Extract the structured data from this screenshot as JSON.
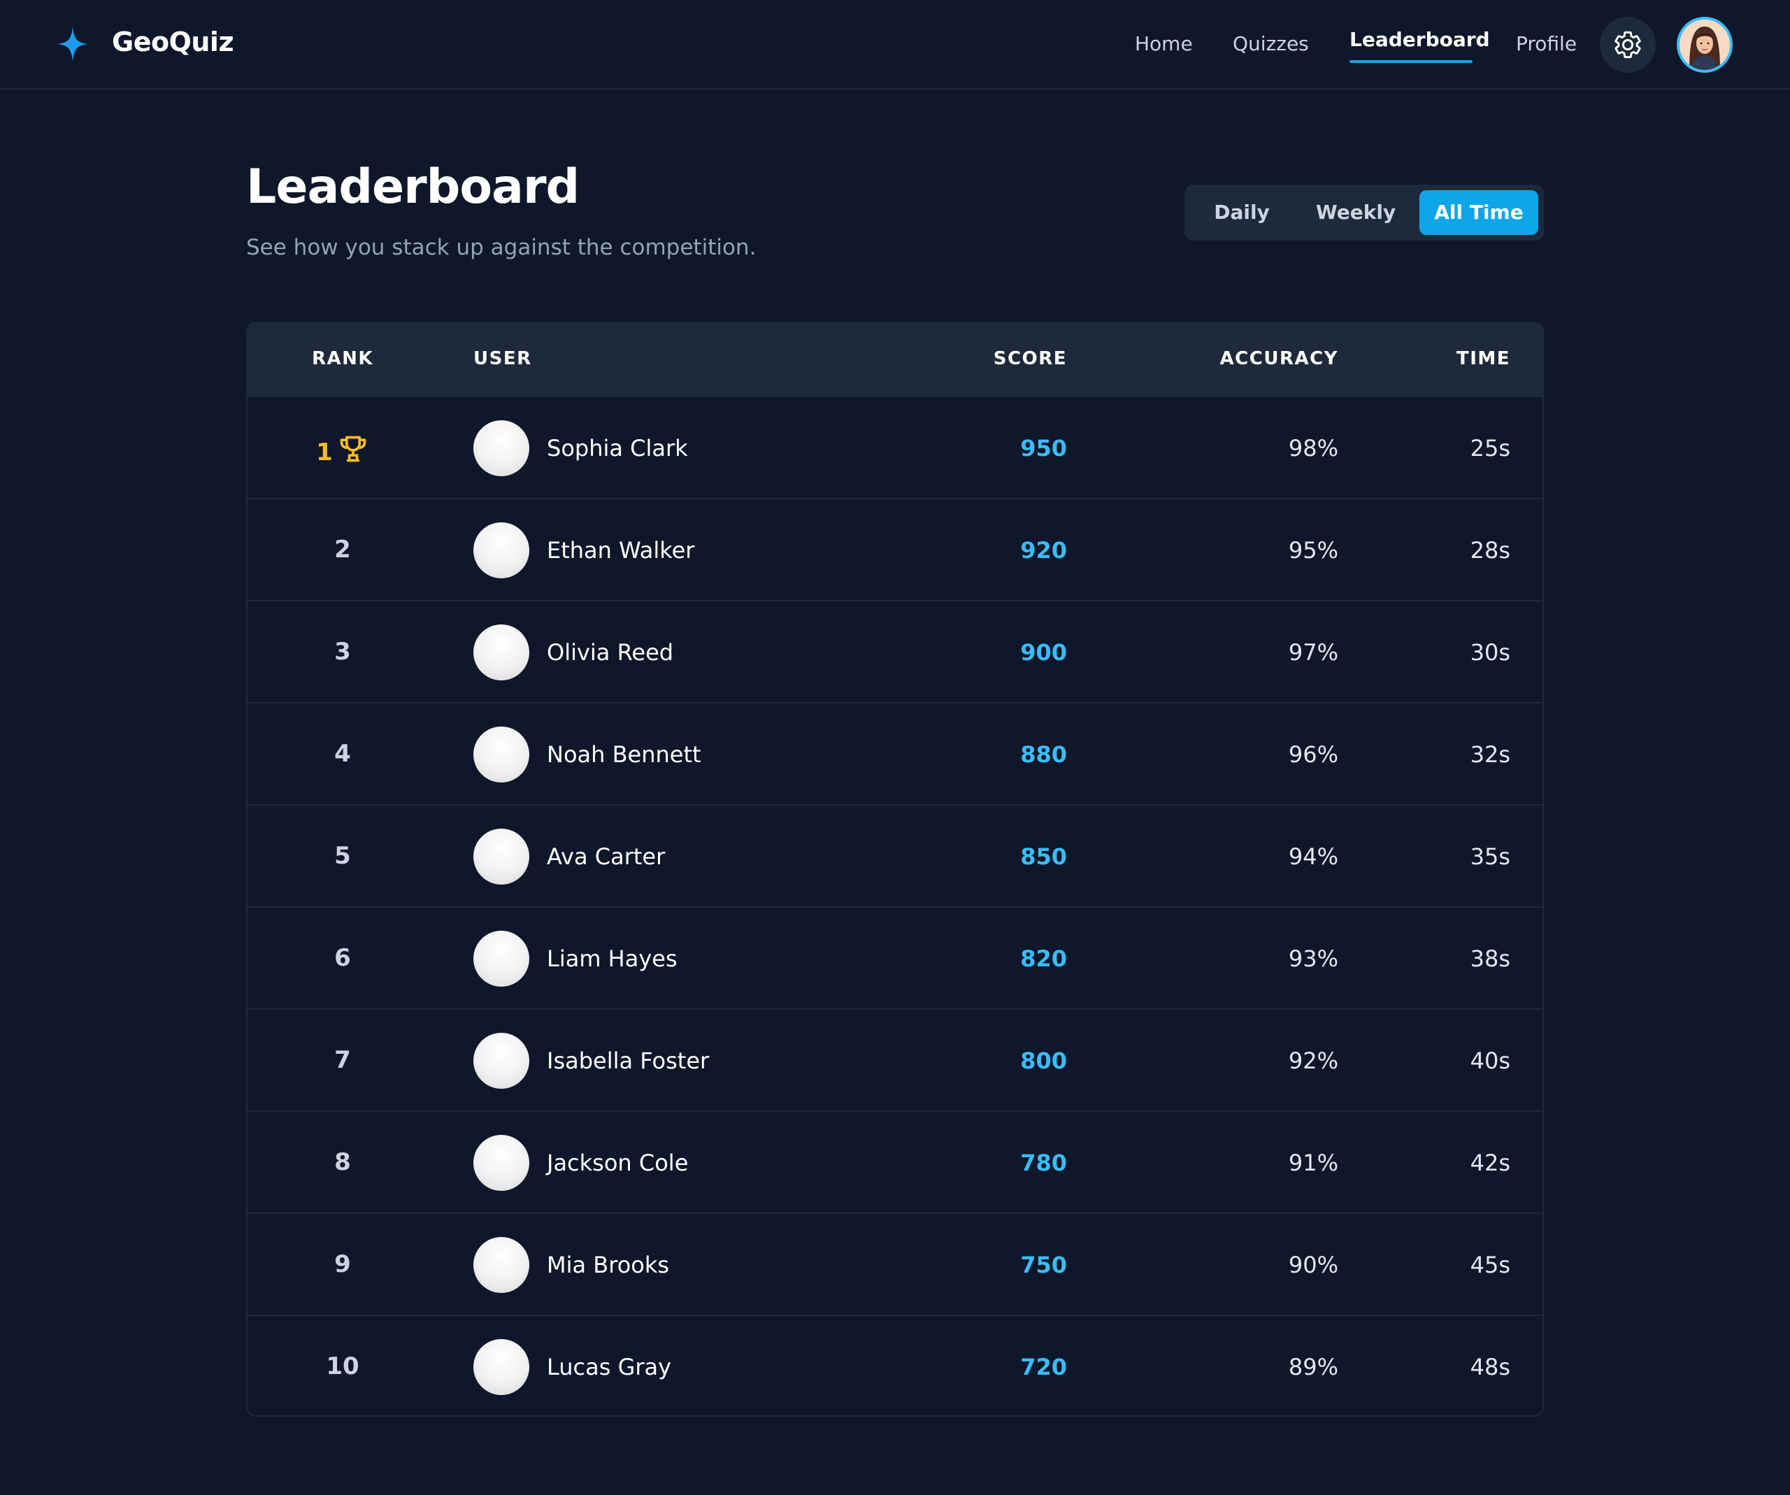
{
  "app": {
    "brand": "GeoQuiz",
    "accent_color": "#0ea5e9",
    "logo_icon": "sparkle-star-icon"
  },
  "nav": {
    "items": [
      "Home",
      "Quizzes",
      "Leaderboard",
      "Profile"
    ],
    "active": "Leaderboard",
    "settings_icon": "gear-icon",
    "avatar_icon": "user-avatar"
  },
  "page": {
    "title": "Leaderboard",
    "subtitle": "See how you stack up against the competition."
  },
  "filters": {
    "options": [
      "Daily",
      "Weekly",
      "All Time"
    ],
    "selected": "All Time"
  },
  "table": {
    "columns": [
      "RANK",
      "USER",
      "SCORE",
      "ACCURACY",
      "TIME"
    ],
    "rows": [
      {
        "rank": "1",
        "user": "Sophia Clark",
        "score": "950",
        "accuracy": "98%",
        "time": "25s",
        "badge": "trophy-icon"
      },
      {
        "rank": "2",
        "user": "Ethan Walker",
        "score": "920",
        "accuracy": "95%",
        "time": "28s"
      },
      {
        "rank": "3",
        "user": "Olivia Reed",
        "score": "900",
        "accuracy": "97%",
        "time": "30s"
      },
      {
        "rank": "4",
        "user": "Noah Bennett",
        "score": "880",
        "accuracy": "96%",
        "time": "32s"
      },
      {
        "rank": "5",
        "user": "Ava Carter",
        "score": "850",
        "accuracy": "94%",
        "time": "35s"
      },
      {
        "rank": "6",
        "user": "Liam Hayes",
        "score": "820",
        "accuracy": "93%",
        "time": "38s"
      },
      {
        "rank": "7",
        "user": "Isabella Foster",
        "score": "800",
        "accuracy": "92%",
        "time": "40s"
      },
      {
        "rank": "8",
        "user": "Jackson Cole",
        "score": "780",
        "accuracy": "91%",
        "time": "42s"
      },
      {
        "rank": "9",
        "user": "Mia Brooks",
        "score": "750",
        "accuracy": "90%",
        "time": "45s"
      },
      {
        "rank": "10",
        "user": "Lucas Gray",
        "score": "720",
        "accuracy": "89%",
        "time": "48s"
      }
    ]
  }
}
